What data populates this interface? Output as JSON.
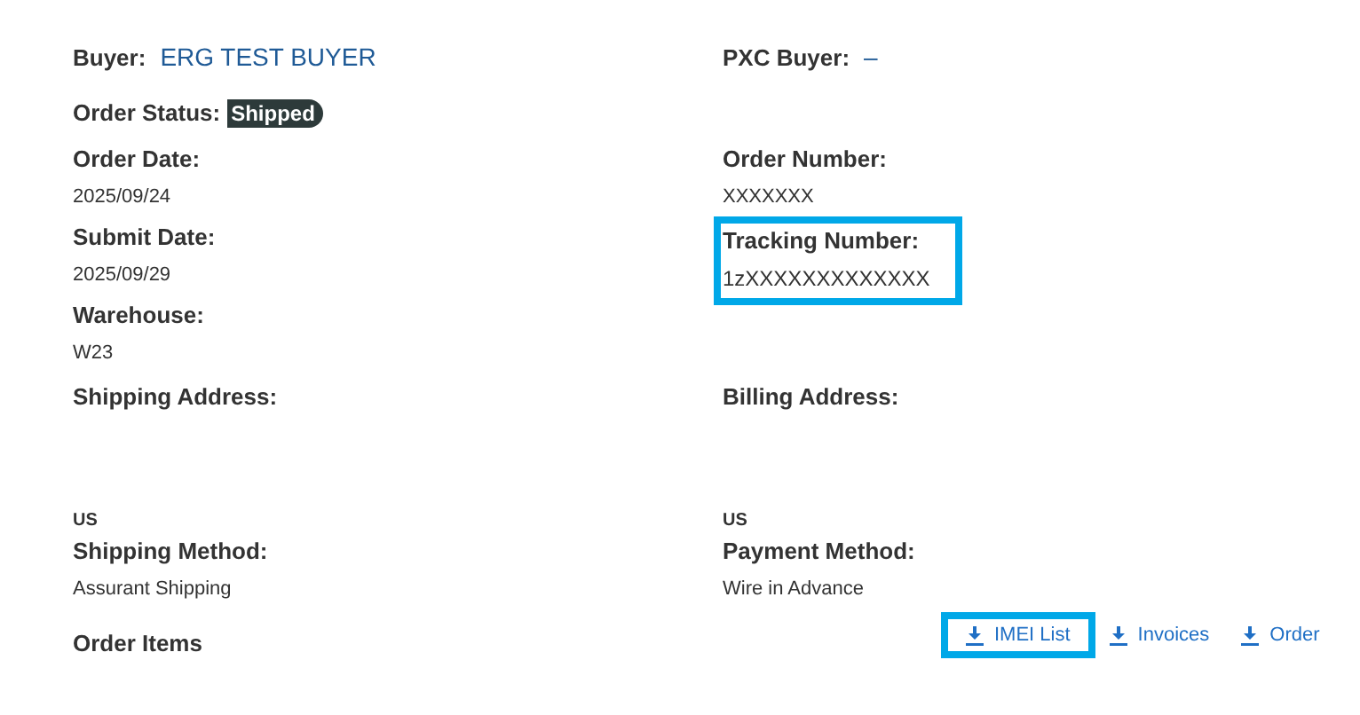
{
  "rows": [
    [
      {
        "kind": "inline",
        "label": "Buyer:",
        "value": "ERG TEST BUYER"
      },
      {
        "kind": "inline",
        "label": "PXC Buyer:",
        "value": "–"
      }
    ],
    [
      {
        "kind": "status",
        "label": "Order Status:",
        "value": "Shipped"
      },
      null
    ],
    [
      {
        "kind": "stacked",
        "label": "Order Date:",
        "value": "2025/09/24",
        "highlighted": false
      },
      {
        "kind": "stacked",
        "label": "Order Number:",
        "value": "XXXXXXX",
        "highlighted": false
      }
    ],
    [
      {
        "kind": "stacked",
        "label": "Submit Date:",
        "value": "2025/09/29",
        "highlighted": false
      },
      {
        "kind": "stacked",
        "label": "Tracking Number:",
        "value": "1zXXXXXXXXXXXXX",
        "highlighted": true
      }
    ],
    [
      {
        "kind": "stacked",
        "label": "Warehouse:",
        "value": "W23",
        "highlighted": false
      },
      null
    ],
    [
      {
        "kind": "address",
        "label": "Shipping Address:"
      },
      {
        "kind": "address",
        "label": "Billing Address:"
      }
    ],
    [
      {
        "kind": "plain",
        "value": "US"
      },
      {
        "kind": "plain",
        "value": "US"
      }
    ],
    [
      {
        "kind": "stacked",
        "label": "Shipping Method:",
        "value": "Assurant Shipping",
        "highlighted": false
      },
      {
        "kind": "stacked",
        "label": "Payment Method:",
        "value": "Wire in Advance",
        "highlighted": false
      }
    ],
    [
      {
        "kind": "heading",
        "label": "Order Items"
      },
      {
        "kind": "links",
        "links": [
          {
            "label": "IMEI List",
            "highlighted": true
          },
          {
            "label": "Invoices",
            "highlighted": false
          },
          {
            "label": "Order",
            "highlighted": false
          }
        ]
      }
    ]
  ]
}
